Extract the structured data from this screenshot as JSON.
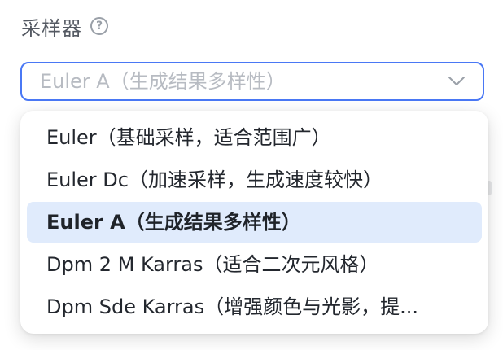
{
  "field": {
    "label": "采样器",
    "help_icon": "question-circle-icon"
  },
  "select": {
    "value": "Euler A（生成结果多样性）",
    "chevron_icon": "chevron-down-icon",
    "accent_color": "#4a78f5"
  },
  "dropdown": {
    "options": [
      {
        "label": "Euler（基础采样，适合范围广）",
        "selected": false
      },
      {
        "label": "Euler Dc（加速采样，生成速度较快）",
        "selected": false
      },
      {
        "label": "Euler A（生成结果多样性）",
        "selected": true
      },
      {
        "label": "Dpm 2 M Karras（适合二次元风格）",
        "selected": false
      },
      {
        "label": "Dpm Sde Karras（增强颜色与光影，提...",
        "selected": false
      }
    ],
    "selected_bg_color": "#e0ebfc"
  }
}
